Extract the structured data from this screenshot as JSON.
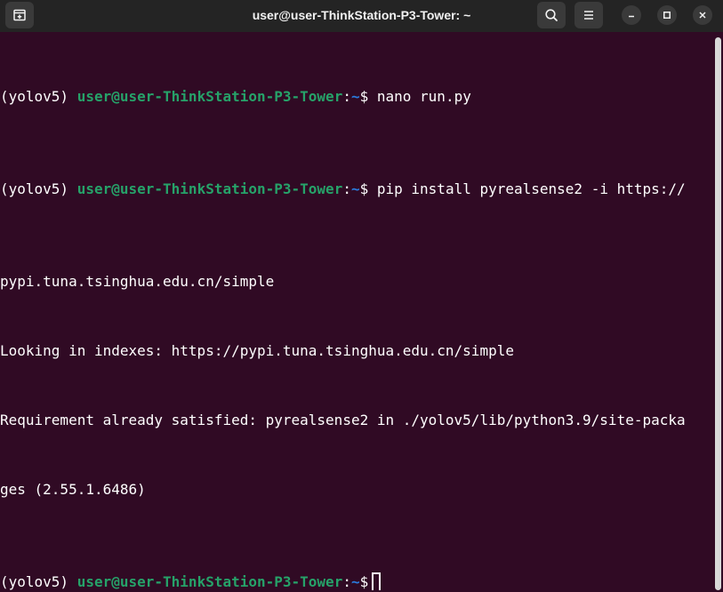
{
  "window": {
    "title": "user@user-ThinkStation-P3-Tower: ~"
  },
  "titlebar": {
    "new_tab_icon": "new-tab-icon",
    "search_icon": "search-icon",
    "menu_icon": "hamburger-menu-icon",
    "minimize_icon": "minimize-icon",
    "maximize_icon": "maximize-icon",
    "close_icon": "close-icon"
  },
  "colors": {
    "background": "#300a24",
    "titlebar": "#242424",
    "prompt_user": "#26a269",
    "prompt_path": "#2a7bde",
    "text": "#ffffff"
  },
  "terminal": {
    "lines": [
      {
        "env": "(yolov5) ",
        "user_host": "user@user-ThinkStation-P3-Tower",
        "sep": ":",
        "path": "~",
        "symbol": "$ ",
        "command": "nano run.py"
      },
      {
        "env": "(yolov5) ",
        "user_host": "user@user-ThinkStation-P3-Tower",
        "sep": ":",
        "path": "~",
        "symbol": "$ ",
        "command": "pip install pyrealsense2 -i https://"
      },
      {
        "text": "pypi.tuna.tsinghua.edu.cn/simple"
      },
      {
        "text": "Looking in indexes: https://pypi.tuna.tsinghua.edu.cn/simple"
      },
      {
        "text": "Requirement already satisfied: pyrealsense2 in ./yolov5/lib/python3.9/site-packa"
      },
      {
        "text": "ges (2.55.1.6486)"
      },
      {
        "env": "(yolov5) ",
        "user_host": "user@user-ThinkStation-P3-Tower",
        "sep": ":",
        "path": "~",
        "symbol": "$",
        "command": ""
      }
    ]
  }
}
